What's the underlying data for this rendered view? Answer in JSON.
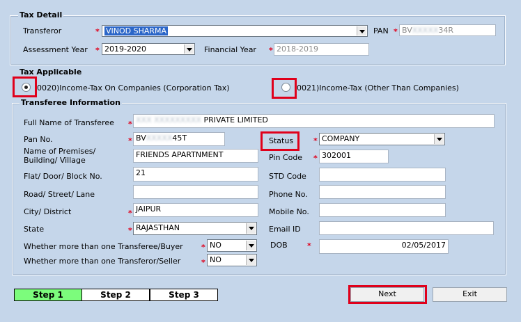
{
  "tax_detail": {
    "legend": "Tax Detail",
    "transferor_label": "Transferor",
    "transferor_value": "VINOD SHARMA",
    "pan_label": "PAN",
    "pan_value_start": "BV",
    "pan_value_end": "34R",
    "assessment_year_label": "Assessment Year",
    "assessment_year_value": "2019-2020",
    "financial_year_label": "Financial Year",
    "financial_year_value": "2018-2019"
  },
  "tax_applicable": {
    "legend": "Tax Applicable",
    "option1_label": "0020)Income-Tax On Companies (Corporation Tax)",
    "option1_selected": true,
    "option2_label": "0021)Income-Tax (Other Than Companies)",
    "option2_selected": false
  },
  "transferee": {
    "legend": "Transferee Information",
    "full_name_label": "Full Name of Transferee",
    "full_name_value": "PRIVATE LIMITED",
    "pan_no_label": "Pan No.",
    "pan_no_start": "BV",
    "pan_no_end": "45T",
    "status_label": "Status",
    "status_value": "COMPANY",
    "premises_label": "Name of Premises/ Building/ Village",
    "premises_value": "FRIENDS APARTNMENT",
    "pin_code_label": "Pin Code",
    "pin_code_value": "302001",
    "flat_label": "Flat/ Door/ Block No.",
    "flat_value": "21",
    "std_code_label": "STD Code",
    "std_code_value": "",
    "road_label": "Road/ Street/ Lane",
    "road_value": "",
    "phone_label": "Phone No.",
    "phone_value": "",
    "city_label": "City/ District",
    "city_value": "JAIPUR",
    "mobile_label": "Mobile No.",
    "mobile_value": "",
    "state_label": "State",
    "state_value": "RAJASTHAN",
    "email_label": "Email ID",
    "email_value": "",
    "multi_transferee_label": "Whether more than one Transferee/Buyer",
    "multi_transferee_value": "NO",
    "dob_label": "DOB",
    "dob_value": "02/05/2017",
    "multi_transferor_label": "Whether more than one Transferor/Seller",
    "multi_transferor_value": "NO"
  },
  "steps": [
    "Step 1",
    "Step 2",
    "Step 3"
  ],
  "buttons": {
    "next": "Next",
    "exit": "Exit"
  },
  "colors": {
    "background": "#c5d6ea",
    "required_star": "#e0001b",
    "highlight_box": "#e0001b",
    "active_step": "#7cfc7c"
  }
}
